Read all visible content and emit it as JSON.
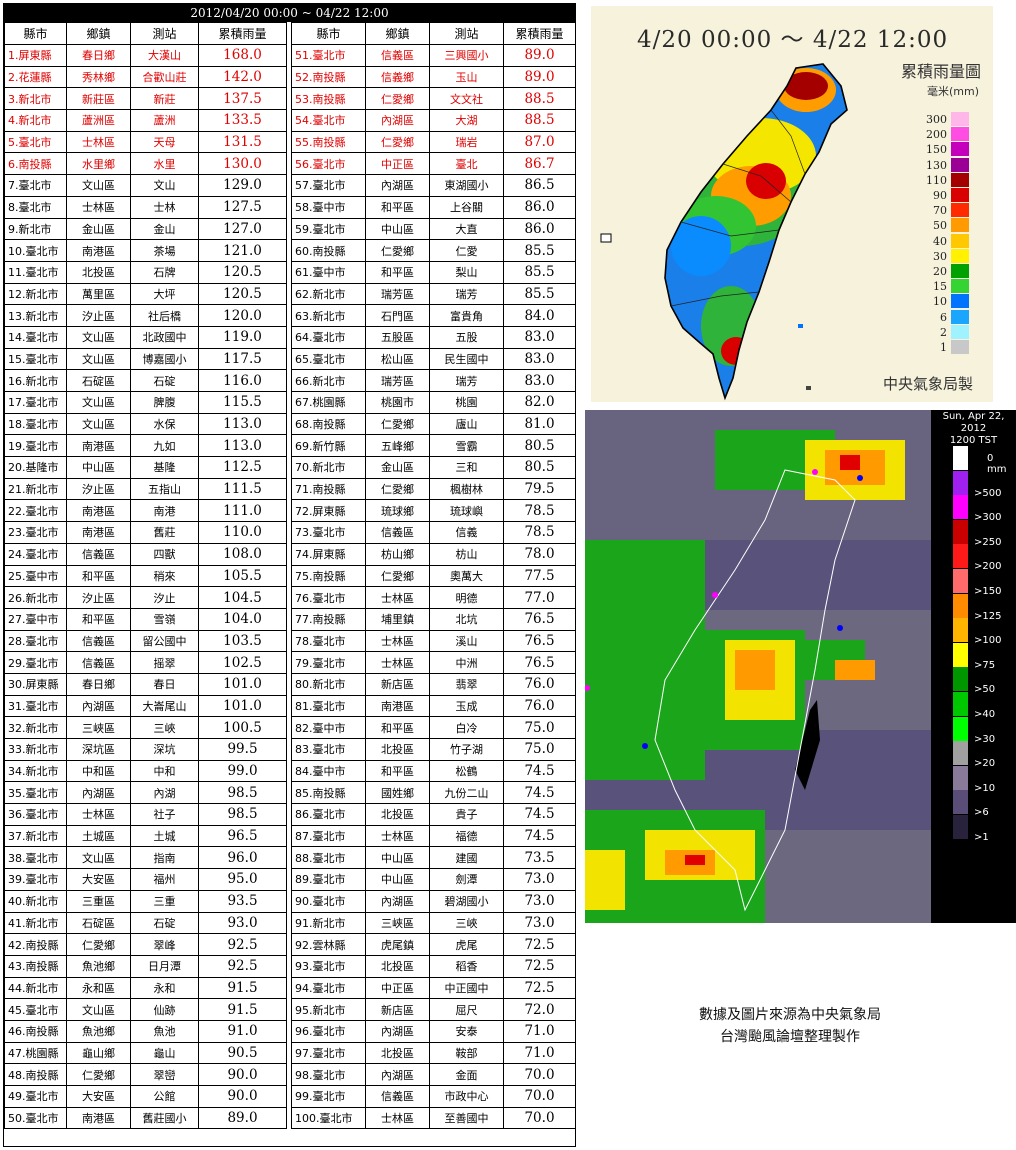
{
  "table": {
    "title": "2012/04/20 00:00 ~ 04/22 12:00",
    "headers": [
      "縣市",
      "鄉鎮",
      "測站",
      "累積雨量"
    ],
    "rows": [
      [
        "1.屏東縣",
        "春日鄉",
        "大漢山",
        "168.0"
      ],
      [
        "2.花蓮縣",
        "秀林鄉",
        "合歡山莊",
        "142.0"
      ],
      [
        "3.新北市",
        "新莊區",
        "新莊",
        "137.5"
      ],
      [
        "4.新北市",
        "蘆洲區",
        "蘆洲",
        "133.5"
      ],
      [
        "5.臺北市",
        "士林區",
        "天母",
        "131.5"
      ],
      [
        "6.南投縣",
        "水里鄉",
        "水里",
        "130.0"
      ],
      [
        "7.臺北市",
        "文山區",
        "文山",
        "129.0"
      ],
      [
        "8.臺北市",
        "士林區",
        "士林",
        "127.5"
      ],
      [
        "9.新北市",
        "金山區",
        "金山",
        "127.0"
      ],
      [
        "10.臺北市",
        "南港區",
        "茶場",
        "121.0"
      ],
      [
        "11.臺北市",
        "北投區",
        "石牌",
        "120.5"
      ],
      [
        "12.新北市",
        "萬里區",
        "大坪",
        "120.5"
      ],
      [
        "13.新北市",
        "汐止區",
        "社后橋",
        "120.0"
      ],
      [
        "14.臺北市",
        "文山區",
        "北政國中",
        "119.0"
      ],
      [
        "15.臺北市",
        "文山區",
        "博嘉國小",
        "117.5"
      ],
      [
        "16.新北市",
        "石碇區",
        "石碇",
        "116.0"
      ],
      [
        "17.臺北市",
        "文山區",
        "脾腹",
        "115.5"
      ],
      [
        "18.臺北市",
        "文山區",
        "水保",
        "113.0"
      ],
      [
        "19.臺北市",
        "南港區",
        "九如",
        "113.0"
      ],
      [
        "20.基隆市",
        "中山區",
        "基隆",
        "112.5"
      ],
      [
        "21.新北市",
        "汐止區",
        "五指山",
        "111.5"
      ],
      [
        "22.臺北市",
        "南港區",
        "南港",
        "111.0"
      ],
      [
        "23.臺北市",
        "南港區",
        "舊莊",
        "110.0"
      ],
      [
        "24.臺北市",
        "信義區",
        "四獸",
        "108.0"
      ],
      [
        "25.臺中市",
        "和平區",
        "稍來",
        "105.5"
      ],
      [
        "26.新北市",
        "汐止區",
        "汐止",
        "104.5"
      ],
      [
        "27.臺中市",
        "和平區",
        "雪嶺",
        "104.0"
      ],
      [
        "28.臺北市",
        "信義區",
        "留公國中",
        "103.5"
      ],
      [
        "29.臺北市",
        "信義區",
        "摇翠",
        "102.5"
      ],
      [
        "30.屏東縣",
        "春日鄉",
        "春日",
        "101.0"
      ],
      [
        "31.臺北市",
        "內湖區",
        "大崙尾山",
        "101.0"
      ],
      [
        "32.新北市",
        "三峽區",
        "三峽",
        "100.5"
      ],
      [
        "33.新北市",
        "深坑區",
        "深坑",
        "99.5"
      ],
      [
        "34.新北市",
        "中和區",
        "中和",
        "99.0"
      ],
      [
        "35.臺北市",
        "內湖區",
        "內湖",
        "98.5"
      ],
      [
        "36.臺北市",
        "士林區",
        "社子",
        "98.5"
      ],
      [
        "37.新北市",
        "土城區",
        "土城",
        "96.5"
      ],
      [
        "38.臺北市",
        "文山區",
        "指南",
        "96.0"
      ],
      [
        "39.臺北市",
        "大安區",
        "福州",
        "95.0"
      ],
      [
        "40.新北市",
        "三重區",
        "三重",
        "93.5"
      ],
      [
        "41.新北市",
        "石碇區",
        "石碇",
        "93.0"
      ],
      [
        "42.南投縣",
        "仁愛鄉",
        "翠峰",
        "92.5"
      ],
      [
        "43.南投縣",
        "魚池鄉",
        "日月潭",
        "92.5"
      ],
      [
        "44.新北市",
        "永和區",
        "永和",
        "91.5"
      ],
      [
        "45.臺北市",
        "文山區",
        "仙跡",
        "91.5"
      ],
      [
        "46.南投縣",
        "魚池鄉",
        "魚池",
        "91.0"
      ],
      [
        "47.桃園縣",
        "龜山鄉",
        "龜山",
        "90.5"
      ],
      [
        "48.南投縣",
        "仁愛鄉",
        "翠巒",
        "90.0"
      ],
      [
        "49.臺北市",
        "大安區",
        "公館",
        "90.0"
      ],
      [
        "50.臺北市",
        "南港區",
        "舊莊國小",
        "89.0"
      ],
      [
        "51.臺北市",
        "信義區",
        "三興國小",
        "89.0"
      ],
      [
        "52.南投縣",
        "信義鄉",
        "玉山",
        "89.0"
      ],
      [
        "53.南投縣",
        "仁愛鄉",
        "文文社",
        "88.5"
      ],
      [
        "54.臺北市",
        "內湖區",
        "大湖",
        "88.5"
      ],
      [
        "55.南投縣",
        "仁愛鄉",
        "瑞岩",
        "87.0"
      ],
      [
        "56.臺北市",
        "中正區",
        "臺北",
        "86.7"
      ],
      [
        "57.臺北市",
        "內湖區",
        "東湖國小",
        "86.5"
      ],
      [
        "58.臺中市",
        "和平區",
        "上谷關",
        "86.0"
      ],
      [
        "59.臺北市",
        "中山區",
        "大直",
        "86.0"
      ],
      [
        "60.南投縣",
        "仁愛鄉",
        "仁愛",
        "85.5"
      ],
      [
        "61.臺中市",
        "和平區",
        "梨山",
        "85.5"
      ],
      [
        "62.新北市",
        "瑞芳區",
        "瑞芳",
        "85.5"
      ],
      [
        "63.新北市",
        "石門區",
        "富貴角",
        "84.0"
      ],
      [
        "64.臺北市",
        "五股區",
        "五股",
        "83.0"
      ],
      [
        "65.臺北市",
        "松山區",
        "民生國中",
        "83.0"
      ],
      [
        "66.新北市",
        "瑞芳區",
        "瑞芳",
        "83.0"
      ],
      [
        "67.桃園縣",
        "桃園市",
        "桃園",
        "82.0"
      ],
      [
        "68.南投縣",
        "仁愛鄉",
        "廬山",
        "81.0"
      ],
      [
        "69.新竹縣",
        "五峰鄉",
        "雪霸",
        "80.5"
      ],
      [
        "70.新北市",
        "金山區",
        "三和",
        "80.5"
      ],
      [
        "71.南投縣",
        "仁愛鄉",
        "楓樹林",
        "79.5"
      ],
      [
        "72.屏東縣",
        "琉球鄉",
        "琉球嶼",
        "78.5"
      ],
      [
        "73.臺北市",
        "信義區",
        "信義",
        "78.5"
      ],
      [
        "74.屏東縣",
        "枋山鄉",
        "枋山",
        "78.0"
      ],
      [
        "75.南投縣",
        "仁愛鄉",
        "奧萬大",
        "77.5"
      ],
      [
        "76.臺北市",
        "士林區",
        "明德",
        "77.0"
      ],
      [
        "77.南投縣",
        "埔里鎮",
        "北坑",
        "76.5"
      ],
      [
        "78.臺北市",
        "士林區",
        "溪山",
        "76.5"
      ],
      [
        "79.臺北市",
        "士林區",
        "中洲",
        "76.5"
      ],
      [
        "80.新北市",
        "新店區",
        "翡翠",
        "76.0"
      ],
      [
        "81.臺北市",
        "南港區",
        "玉成",
        "76.0"
      ],
      [
        "82.臺中市",
        "和平區",
        "白冷",
        "75.0"
      ],
      [
        "83.臺北市",
        "北投區",
        "竹子湖",
        "75.0"
      ],
      [
        "84.臺中市",
        "和平區",
        "松鶴",
        "74.5"
      ],
      [
        "85.南投縣",
        "國姓鄉",
        "九份二山",
        "74.5"
      ],
      [
        "86.臺北市",
        "北投區",
        "貴子",
        "74.5"
      ],
      [
        "87.臺北市",
        "士林區",
        "福德",
        "74.5"
      ],
      [
        "88.臺北市",
        "中山區",
        "建國",
        "73.5"
      ],
      [
        "89.臺北市",
        "中山區",
        "劍潭",
        "73.0"
      ],
      [
        "90.臺北市",
        "內湖區",
        "碧湖國小",
        "73.0"
      ],
      [
        "91.新北市",
        "三峽區",
        "三峽",
        "73.0"
      ],
      [
        "92.雲林縣",
        "虎尾鎮",
        "虎尾",
        "72.5"
      ],
      [
        "93.臺北市",
        "北投區",
        "稻香",
        "72.5"
      ],
      [
        "94.臺北市",
        "中正區",
        "中正國中",
        "72.5"
      ],
      [
        "95.新北市",
        "新店區",
        "屈尺",
        "72.0"
      ],
      [
        "96.臺北市",
        "內湖區",
        "安泰",
        "71.0"
      ],
      [
        "97.臺北市",
        "北投區",
        "鞍部",
        "71.0"
      ],
      [
        "98.臺北市",
        "內湖區",
        "金面",
        "70.0"
      ],
      [
        "99.臺北市",
        "信義區",
        "市政中心",
        "70.0"
      ],
      [
        "100.臺北市",
        "士林區",
        "至善國中",
        "70.0"
      ]
    ],
    "highlight_count": 6,
    "highlight_color": "#e00000"
  },
  "rain_map": {
    "title": "4/20 00:00 ～ 4/22 12:00",
    "subtitle": "累積雨量圖",
    "unit": "毫米(mm)",
    "credit": "中央氣象局製",
    "legend": [
      {
        "label": "300",
        "color": "#ffb7e9"
      },
      {
        "label": "200",
        "color": "#ff4ce3"
      },
      {
        "label": "150",
        "color": "#c400bd"
      },
      {
        "label": "130",
        "color": "#9a0096"
      },
      {
        "label": "110",
        "color": "#a50000"
      },
      {
        "label": "90",
        "color": "#d80000"
      },
      {
        "label": "70",
        "color": "#ff2a00"
      },
      {
        "label": "50",
        "color": "#ff9b00"
      },
      {
        "label": "40",
        "color": "#ffc800"
      },
      {
        "label": "30",
        "color": "#fff100"
      },
      {
        "label": "20",
        "color": "#00a100"
      },
      {
        "label": "15",
        "color": "#33d433"
      },
      {
        "label": "10",
        "color": "#0074ff"
      },
      {
        "label": "6",
        "color": "#1aa5ff"
      },
      {
        "label": "2",
        "color": "#9ff2ff"
      },
      {
        "label": "1",
        "color": "#c8c8c8"
      }
    ]
  },
  "radar": {
    "time_line1": "Sun, Apr 22, 2012",
    "time_line2": "1200 TST",
    "scale": [
      {
        "label": "0 mm",
        "color": "#ffffff"
      },
      {
        "label": ">500",
        "color": "#a020f0"
      },
      {
        "label": ">300",
        "color": "#ff00ff"
      },
      {
        "label": ">250",
        "color": "#c80000"
      },
      {
        "label": ">200",
        "color": "#ff1a1a"
      },
      {
        "label": ">150",
        "color": "#ff6a6a"
      },
      {
        "label": ">125",
        "color": "#ff8c00"
      },
      {
        "label": ">100",
        "color": "#ffb400"
      },
      {
        "label": ">75",
        "color": "#ffff00"
      },
      {
        "label": ">50",
        "color": "#009600"
      },
      {
        "label": ">40",
        "color": "#00c800"
      },
      {
        "label": ">30",
        "color": "#00ff00"
      },
      {
        "label": ">20",
        "color": "#a0a0a0"
      },
      {
        "label": ">10",
        "color": "#8a7a9a"
      },
      {
        "label": ">6",
        "color": "#5a4e78"
      },
      {
        "label": ">1",
        "color": "#28223c"
      }
    ]
  },
  "credits": {
    "line1": "數據及圖片來源為中央氣象局",
    "line2": "台灣颱風論壇整理製作"
  }
}
